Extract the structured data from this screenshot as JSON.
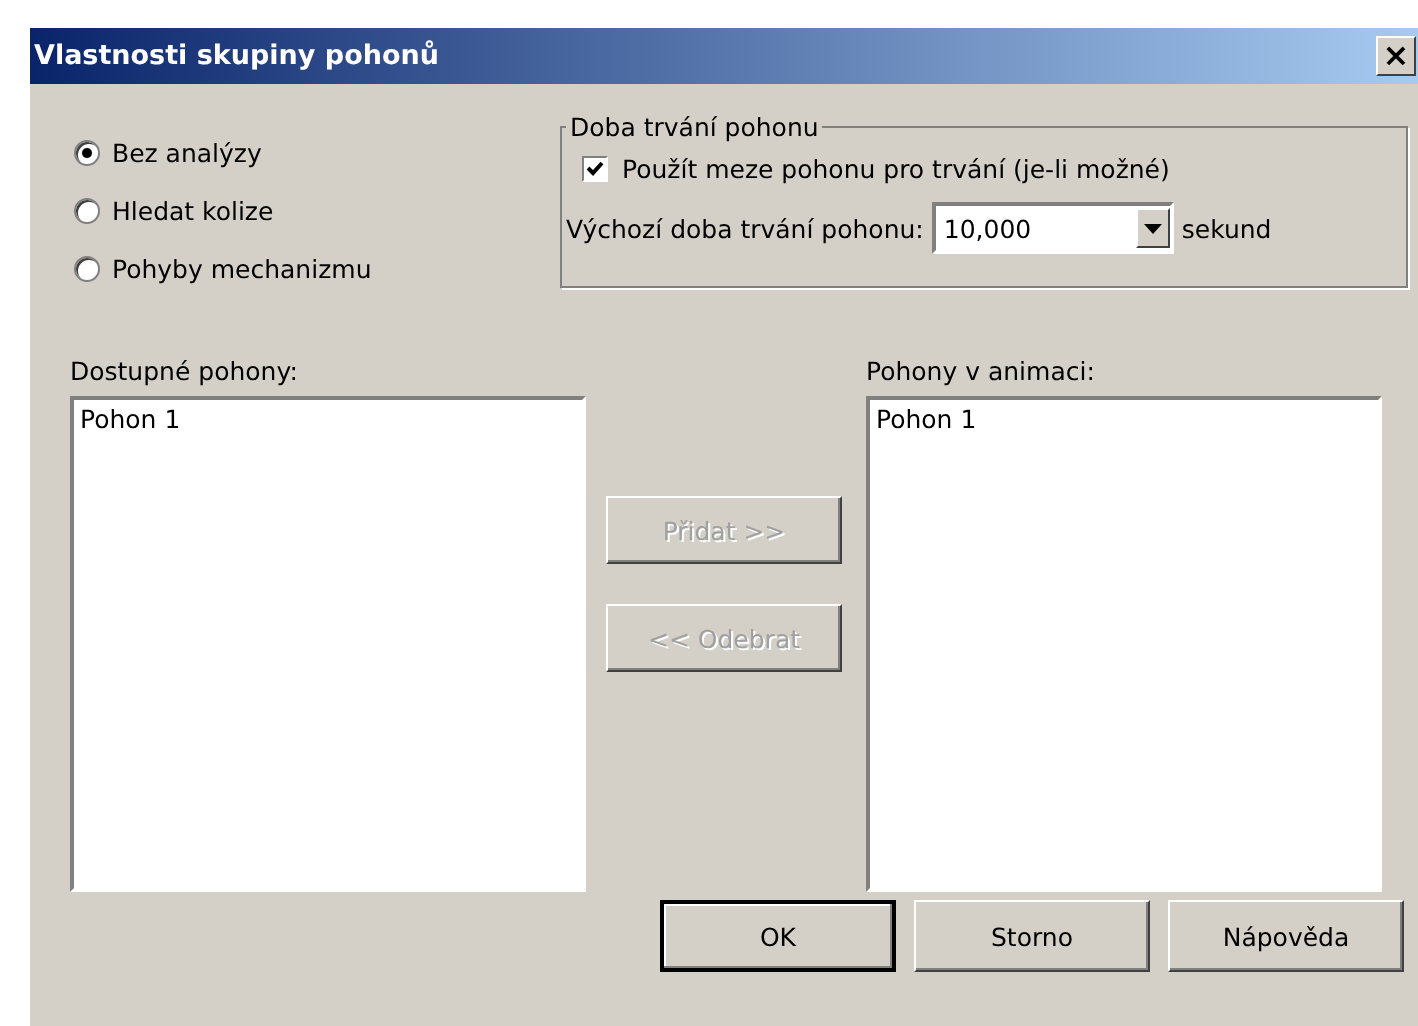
{
  "window": {
    "title": "Vlastnosti skupiny pohonů",
    "close": "×"
  },
  "analysis_options": [
    {
      "label": "Bez analýzy",
      "selected": true
    },
    {
      "label": "Hledat kolize",
      "selected": false
    },
    {
      "label": "Pohyby mechanizmu",
      "selected": false
    }
  ],
  "duration_group": {
    "title": "Doba trvání pohonu",
    "use_limits": {
      "label": "Použít meze pohonu pro trvání (je-li možné)",
      "checked": true
    },
    "default_label": "Výchozí doba trvání pohonu:",
    "default_value": "10,000",
    "unit": "sekund"
  },
  "available": {
    "label": "Dostupné pohony:",
    "items": [
      "Pohon 1"
    ]
  },
  "in_animation": {
    "label": "Pohony v animaci:",
    "items": [
      "Pohon 1"
    ]
  },
  "move_buttons": [
    {
      "label": "Přidat >>",
      "disabled": true
    },
    {
      "label": "<< Odebrat",
      "disabled": true
    }
  ],
  "buttons": [
    {
      "label": "OK",
      "default": true
    },
    {
      "label": "Storno",
      "default": false
    },
    {
      "label": "Nápověda",
      "default": false
    }
  ]
}
